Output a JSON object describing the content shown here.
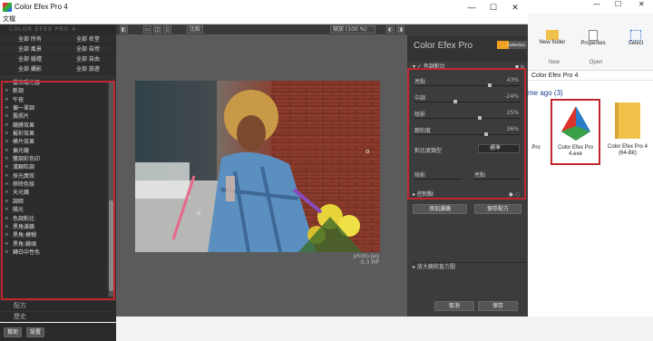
{
  "window": {
    "title": "Color Efex Pro 4",
    "menu": "文檔"
  },
  "left": {
    "logo": "COLOR EFEX PRO 4",
    "categories": [
      "全部 所有",
      "全部 名堂",
      "全部 風景",
      "全部 自然",
      "全部 婚禮",
      "全部 自由",
      "全部 攝影",
      "全部 旅遊"
    ],
    "filters": [
      "雙次曝光器",
      "斬調",
      "午夜",
      "偏一單調",
      "舊照片",
      "鏡膜效果",
      "擬彩效果",
      "模片效果",
      "偏光鏡",
      "雙調彩色印",
      "漢顆粒調",
      "探光廣效",
      "移除色版",
      "天光鏡",
      "調暗",
      "陽光",
      "色調對比",
      "黑角濾鏡",
      "黑角:模糊",
      "黑角:鏡頭",
      "轉白中性色"
    ],
    "recipes": "配方",
    "history": "歷史",
    "btn_help": "幫助",
    "btn_settings": "設置"
  },
  "toolbar": {
    "compare": "比較",
    "zoom": "縮放 (100 %)"
  },
  "photo": {
    "filename": "photo.jpg",
    "size": "0.3 MP"
  },
  "right": {
    "title": "Color Efex Pro",
    "badge": "Collection",
    "section": "色調對比",
    "sliders": [
      {
        "label": "亮點",
        "value": "43%",
        "level": 0.72
      },
      {
        "label": "中調",
        "value": "-24%",
        "level": 0.38
      },
      {
        "label": "陰影",
        "value": "25%",
        "level": 0.62
      },
      {
        "label": "飽和度",
        "value": "36%",
        "level": 0.68
      }
    ],
    "contrast_type_label": "對比度類型",
    "contrast_type_value": "標準",
    "shadow_label": "陰影",
    "highlight_label": "亮點",
    "control_points": "控制點",
    "add_filter": "添加濾鏡",
    "save_recipe": "保存配方",
    "zoom_label": "放大鏡和直方圖",
    "cancel": "取消",
    "save": "保存"
  },
  "explorer": {
    "new_folder": "New folder",
    "properties": "Properties",
    "select": "Select",
    "group_new": "New",
    "group_open": "Open",
    "breadcrumb": "Color Efex Pro 4",
    "time_group": "me ago (3)",
    "files": [
      "Pro",
      "Color Efex Pro 4.exe",
      "Color Efex Pro 4 (64-Bit)"
    ]
  }
}
